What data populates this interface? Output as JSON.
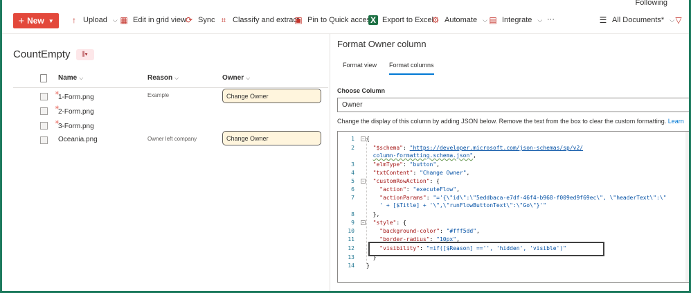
{
  "toolbar": {
    "following": "Following",
    "new_label": "New",
    "upload": "Upload",
    "edit_grid": "Edit in grid view",
    "sync": "Sync",
    "classify": "Classify and extract",
    "pin": "Pin to Quick access",
    "export": "Export to Excel",
    "automate": "Automate",
    "integrate": "Integrate",
    "more": "···",
    "view": "All Documents*"
  },
  "library": {
    "title": "CountEmpty",
    "columns": {
      "name": "Name",
      "reason": "Reason",
      "owner": "Owner"
    },
    "rows": [
      {
        "name": "1-Form.png",
        "reason": "Example",
        "owner_button": "Change Owner",
        "is_new": true
      },
      {
        "name": "2-Form.png",
        "reason": "",
        "owner_button": "",
        "is_new": true
      },
      {
        "name": "3-Form.png",
        "reason": "",
        "owner_button": "",
        "is_new": true
      },
      {
        "name": "Oceania.png",
        "reason": "Owner left company",
        "owner_button": "Change Owner",
        "is_new": false
      }
    ]
  },
  "pane": {
    "title": "Format Owner column",
    "tabs": [
      "Format view",
      "Format columns"
    ],
    "active_tab": "Format columns",
    "choose_label": "Choose Column",
    "selected_column": "Owner",
    "help_text": "Change the display of this column by adding JSON below. Remove the text from the box to clear the custom formatting.",
    "help_link": "Learn"
  },
  "editor": {
    "lines": [
      {
        "n": "1",
        "text": "{"
      },
      {
        "n": "2",
        "text": "  \"$schema\": \"https://developer.microsoft.com/json-schemas/sp/v2/"
      },
      {
        "n": "",
        "text": "  column-formatting.schema.json\","
      },
      {
        "n": "3",
        "text": "  \"elmType\": \"button\","
      },
      {
        "n": "4",
        "text": "  \"txtContent\": \"Change Owner\","
      },
      {
        "n": "5",
        "text": "  \"customRowAction\": {"
      },
      {
        "n": "6",
        "text": "    \"action\": \"executeFlow\","
      },
      {
        "n": "7",
        "text": "    \"actionParams\": \"='{\\\"id\\\":\\\"5eddbaca-e7df-46f4-b968-f009ed9f69ec\\\", \\\"headerText\\\":\\\""
      },
      {
        "n": "",
        "text": "    ' + [$Title] + '\\\",\\\"runFlowButtonText\\\":\\\"Go\\\"}'\""
      },
      {
        "n": "8",
        "text": "  },"
      },
      {
        "n": "9",
        "text": "  \"style\": {"
      },
      {
        "n": "10",
        "text": "    \"background-color\": \"#fff5dd\","
      },
      {
        "n": "11",
        "text": "    \"border-radius\": \"10px\","
      },
      {
        "n": "12",
        "text": "    \"visibility\": \"=if([$Reason] =='', 'hidden', 'visible')\""
      },
      {
        "n": "13",
        "text": "  }"
      },
      {
        "n": "14",
        "text": "}"
      }
    ]
  },
  "colors": {
    "accent": "#0078d4",
    "new_button": "#e3483b",
    "owner_button_bg": "#fff5dd",
    "frame": "#1e7b5e"
  }
}
